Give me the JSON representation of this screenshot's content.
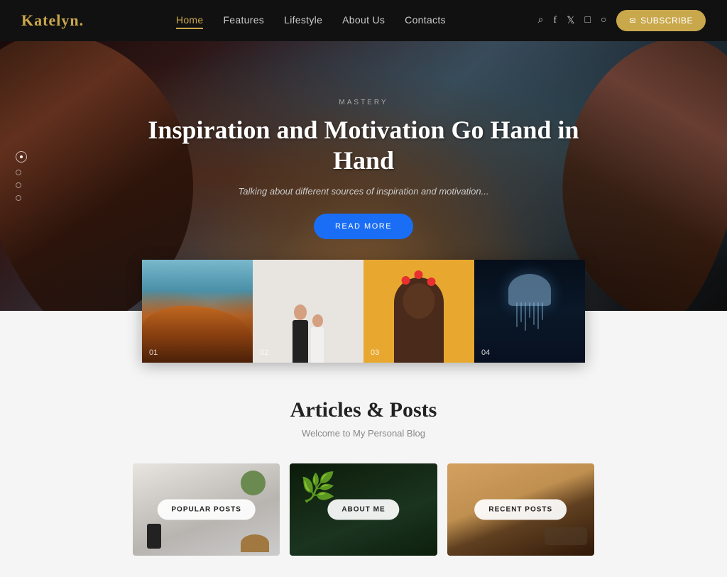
{
  "brand": {
    "name": "Katelyn",
    "dot": "."
  },
  "navbar": {
    "links": [
      {
        "label": "Home",
        "active": true
      },
      {
        "label": "Features",
        "active": false
      },
      {
        "label": "Lifestyle",
        "active": false
      },
      {
        "label": "About Us",
        "active": false
      },
      {
        "label": "Contacts",
        "active": false
      }
    ],
    "subscribe_label": "SUBSCRIBE"
  },
  "hero": {
    "tag": "MASTERY",
    "title": "Inspiration and Motivation Go Hand in Hand",
    "subtitle": "Talking about different sources of inspiration and motivation...",
    "cta": "READ MORE",
    "dots": [
      "active",
      "inactive",
      "inactive",
      "inactive"
    ]
  },
  "gallery": {
    "items": [
      {
        "num": "01"
      },
      {
        "num": "02"
      },
      {
        "num": "03"
      },
      {
        "num": "04"
      }
    ]
  },
  "articles": {
    "title": "Articles & Posts",
    "subtitle": "Welcome to My Personal Blog",
    "cards": [
      {
        "label": "POPULAR POSTS"
      },
      {
        "label": "ABOUT ME"
      },
      {
        "label": "RECENT POSTS"
      }
    ]
  }
}
